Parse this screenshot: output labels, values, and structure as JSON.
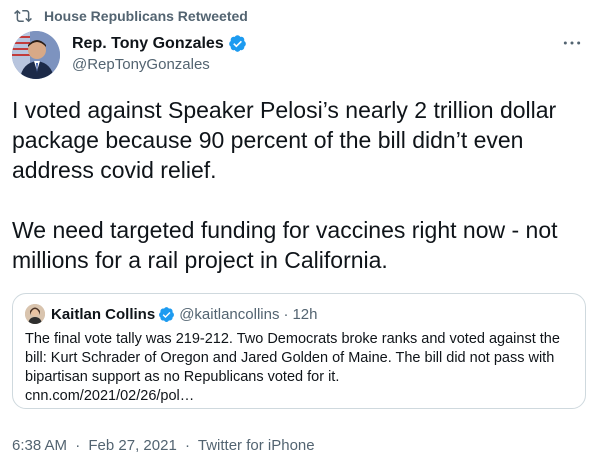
{
  "retweet_banner": {
    "icon": "retweet-icon",
    "text": "House Republicans Retweeted"
  },
  "author": {
    "name": "Rep. Tony Gonzales",
    "handle": "@RepTonyGonzales",
    "verified": true,
    "avatar_icon": "user-avatar"
  },
  "more_icon": "more-options-icon",
  "tweet": {
    "text": "I voted against Speaker Pelosi’s nearly 2 trillion dollar package because 90 percent of the bill didn’t even address covid relief.\n\nWe need targeted funding  for vaccines right now - not millions for a rail project in California."
  },
  "quote": {
    "name": "Kaitlan Collins",
    "handle": "@kaitlancollins",
    "separator": "·",
    "time": "12h",
    "verified": true,
    "text": "The final vote tally was 219-212. Two Democrats broke ranks and voted against the bill: Kurt Schrader of Oregon and Jared Golden of Maine. The bill did not pass with bipartisan support as no Republicans voted for it.",
    "link": "cnn.com/2021/02/26/pol…"
  },
  "footer": {
    "time": "6:38 AM",
    "separator": "·",
    "date": "Feb 27, 2021",
    "separator2": "·",
    "source": "Twitter for iPhone"
  },
  "colors": {
    "text": "#0f1419",
    "secondary": "#536471",
    "verified_blue": "#1d9bf0",
    "border": "#cfd9de"
  }
}
